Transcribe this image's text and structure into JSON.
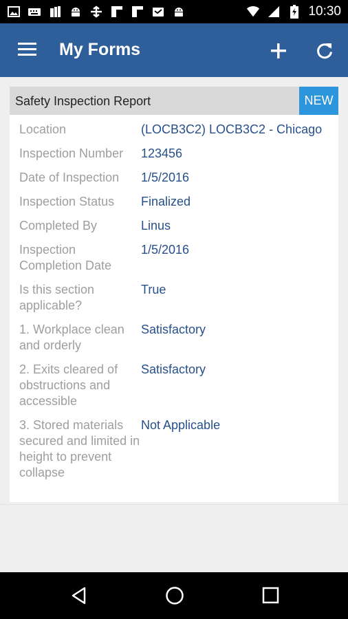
{
  "status_bar": {
    "time": "10:30",
    "left_icons": [
      "image-icon",
      "keyboard-icon",
      "files-icon",
      "android-icon",
      "usb-icon",
      "square-icon",
      "square-icon",
      "message-icon",
      "android-icon"
    ],
    "right_icons": [
      "wifi-icon",
      "signal-icon",
      "battery-icon"
    ]
  },
  "appbar": {
    "title": "My Forms"
  },
  "card": {
    "title": "Safety Inspection Report",
    "badge": "NEW",
    "rows": [
      {
        "label": "Location",
        "value": "(LOCB3C2) LOCB3C2 - Chicago"
      },
      {
        "label": "Inspection Number",
        "value": "123456"
      },
      {
        "label": "Date of Inspection",
        "value": "1/5/2016"
      },
      {
        "label": "Inspection Status",
        "value": "Finalized"
      },
      {
        "label": "Completed By",
        "value": "Linus"
      },
      {
        "label": "Inspection Completion Date",
        "value": "1/5/2016"
      },
      {
        "label": "Is this section applicable?",
        "value": "True"
      },
      {
        "label": "1. Workplace clean and orderly",
        "value": "Satisfactory"
      },
      {
        "label": "2. Exits cleared of obstructions and accessible",
        "value": "Satisfactory"
      },
      {
        "label": "3. Stored materials secured and limited in height to prevent collapse",
        "value": "Not Applicable"
      }
    ]
  },
  "colors": {
    "appbar": "#2f5f9a",
    "badge": "#2d95db",
    "value_text": "#27508a",
    "label_text": "#9e9e9e"
  }
}
